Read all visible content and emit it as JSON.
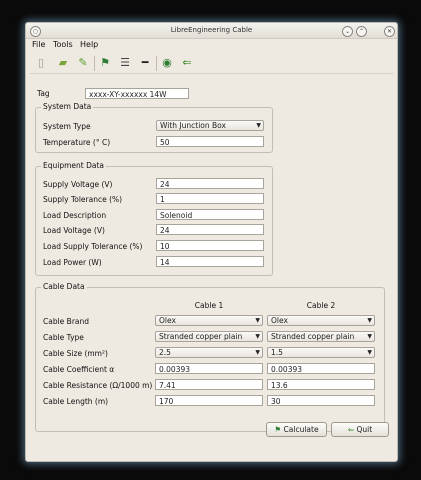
{
  "window": {
    "title": "LibreEngineering Cable"
  },
  "menu": {
    "file": "File",
    "tools": "Tools",
    "help": "Help"
  },
  "toolbar_icons": [
    "new-document-icon",
    "open-folder-icon",
    "tool-wrench-icon",
    "run-person-icon",
    "report-list-icon",
    "cable-icon",
    "record-icon",
    "quit-icon"
  ],
  "tag": {
    "label": "Tag",
    "value": "xxxx-XY-xxxxxx 14W"
  },
  "system": {
    "title": "System Data",
    "type_label": "System Type",
    "type_value": "With Junction Box",
    "temp_label": "Temperature (° C)",
    "temp_value": "50"
  },
  "equipment": {
    "title": "Equipment Data",
    "rows": [
      {
        "label": "Supply Voltage (V)",
        "value": "24"
      },
      {
        "label": "Supply Tolerance (%)",
        "value": "1"
      },
      {
        "label": "Load Description",
        "value": "Solenoid"
      },
      {
        "label": "Load Voltage (V)",
        "value": "24"
      },
      {
        "label": "Load Supply Tolerance (%)",
        "value": "10"
      },
      {
        "label": "Load Power (W)",
        "value": "14"
      }
    ]
  },
  "cable": {
    "title": "Cable Data",
    "col1": "Cable 1",
    "col2": "Cable 2",
    "rows": [
      {
        "label": "Cable Brand",
        "v1": "Olex",
        "v2": "Olex",
        "combo": true
      },
      {
        "label": "Cable Type",
        "v1": "Stranded copper plain",
        "v2": "Stranded copper plain",
        "combo": true
      },
      {
        "label": "Cable Size (mm²)",
        "v1": "2.5",
        "v2": "1.5",
        "combo": true
      },
      {
        "label": "Cable Coefficient α",
        "v1": "0.00393",
        "v2": "0.00393",
        "combo": false
      },
      {
        "label": "Cable Resistance (Ω/1000 m)",
        "v1": "7.41",
        "v2": "13.6",
        "combo": false
      },
      {
        "label": "Cable Length (m)",
        "v1": "170",
        "v2": "30",
        "combo": false
      }
    ]
  },
  "buttons": {
    "calculate": "Calculate",
    "quit": "Quit"
  }
}
